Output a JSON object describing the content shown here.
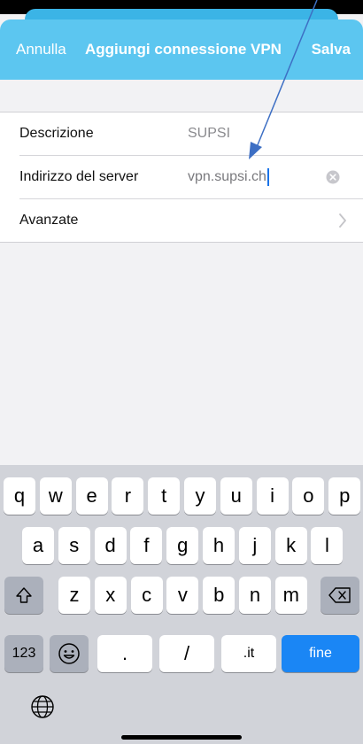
{
  "header": {
    "cancel_label": "Annulla",
    "title": "Aggiungi connessione VPN",
    "save_label": "Salva"
  },
  "form": {
    "rows": [
      {
        "label": "Descrizione",
        "value": "SUPSI"
      },
      {
        "label": "Indirizzo del server",
        "value": "vpn.supsi.ch"
      },
      {
        "label": "Avanzate",
        "value": ""
      }
    ]
  },
  "keyboard": {
    "row1": [
      "q",
      "w",
      "e",
      "r",
      "t",
      "y",
      "u",
      "i",
      "o",
      "p"
    ],
    "row2": [
      "a",
      "s",
      "d",
      "f",
      "g",
      "h",
      "j",
      "k",
      "l"
    ],
    "row3": [
      "z",
      "x",
      "c",
      "v",
      "b",
      "n",
      "m"
    ],
    "numbers_label": "123",
    "dot_label": ".",
    "slash_label": "/",
    "tld_label": ".it",
    "done_label": "fine"
  },
  "colors": {
    "header": "#5cc6f0",
    "done_key": "#1a86f5",
    "arrow": "#3d6fc4"
  },
  "icons": {
    "clear": "clear-circle-icon",
    "chevron": "chevron-right-icon",
    "shift": "shift-icon",
    "backspace": "backspace-icon",
    "emoji": "emoji-icon",
    "globe": "globe-icon"
  }
}
